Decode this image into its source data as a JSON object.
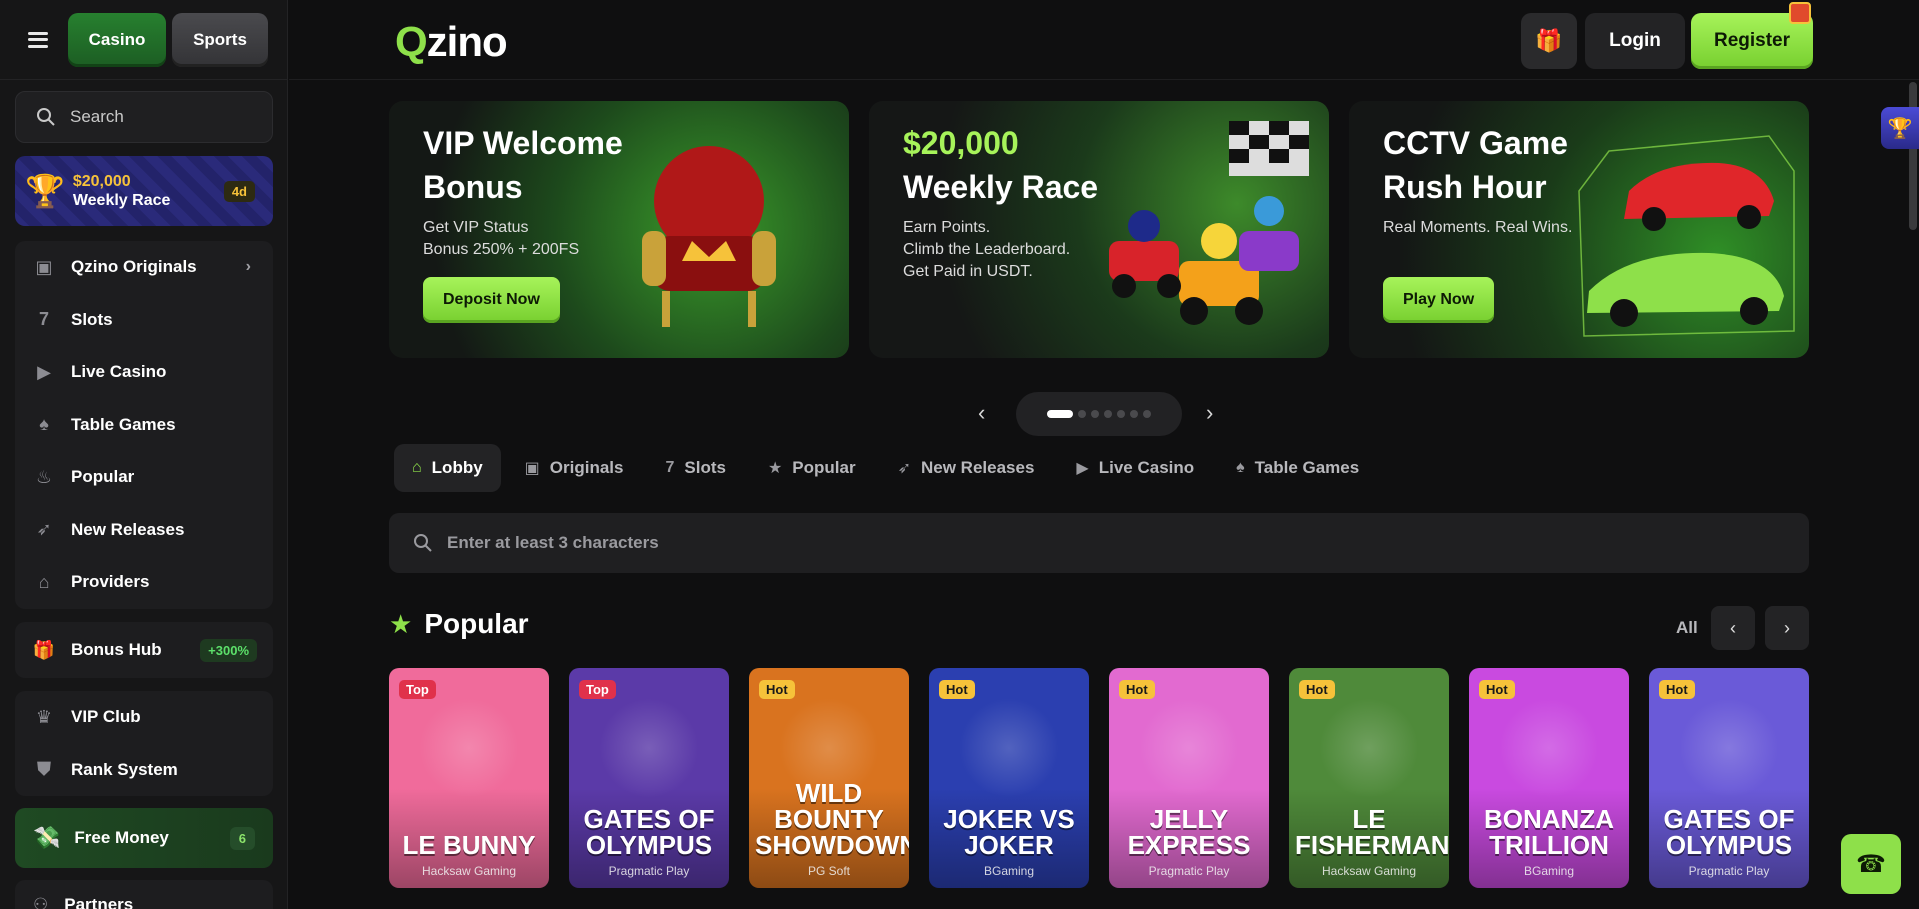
{
  "header": {
    "logo_text": "Qzino",
    "login_label": "Login",
    "register_label": "Register"
  },
  "sidebar": {
    "mode_tabs": [
      "Casino",
      "Sports"
    ],
    "search_label": "Search",
    "race": {
      "amount": "$20,000",
      "label": "Weekly Race",
      "badge": "4d"
    },
    "nav_main": [
      {
        "label": "Qzino Originals",
        "icon": "originals-icon"
      },
      {
        "label": "Slots",
        "icon": "slots-icon"
      },
      {
        "label": "Live Casino",
        "icon": "live-casino-icon"
      },
      {
        "label": "Table Games",
        "icon": "table-games-icon"
      },
      {
        "label": "Popular",
        "icon": "fire-icon"
      },
      {
        "label": "New Releases",
        "icon": "rocket-icon"
      },
      {
        "label": "Providers",
        "icon": "providers-icon"
      }
    ],
    "bonus_hub": {
      "label": "Bonus Hub",
      "badge": "+300%"
    },
    "nav_vip": [
      {
        "label": "VIP Club",
        "icon": "crown-icon"
      },
      {
        "label": "Rank System",
        "icon": "rank-icon"
      }
    ],
    "free_money": {
      "label": "Free Money",
      "badge": "6"
    },
    "partners_label": "Partners"
  },
  "banners": [
    {
      "title_line1": "VIP Welcome",
      "title_line2": "Bonus",
      "sub": [
        "Get VIP Status",
        "Bonus 250% + 200FS"
      ],
      "cta": "Deposit Now"
    },
    {
      "amount": "$20,000",
      "title_line2": "Weekly Race",
      "sub": [
        "Earn Points.",
        "Climb the Leaderboard.",
        "Get Paid in USDT."
      ]
    },
    {
      "title_line1": "CCTV Game",
      "title_line2": "Rush Hour",
      "sub": [
        "Real Moments. Real Wins."
      ],
      "cta": "Play Now"
    }
  ],
  "category_tabs": [
    {
      "label": "Lobby",
      "icon": "home-icon",
      "active": true
    },
    {
      "label": "Originals",
      "icon": "originals-icon"
    },
    {
      "label": "Slots",
      "icon": "slots-icon"
    },
    {
      "label": "Popular",
      "icon": "star-icon"
    },
    {
      "label": "New Releases",
      "icon": "rocket-icon"
    },
    {
      "label": "Live Casino",
      "icon": "live-casino-icon"
    },
    {
      "label": "Table Games",
      "icon": "table-games-icon"
    }
  ],
  "game_search_placeholder": "Enter at least 3 characters",
  "popular": {
    "title": "Popular",
    "all_label": "All",
    "games": [
      {
        "tag": "Top",
        "name": "LE BUNNY",
        "provider": "Hacksaw Gaming",
        "color": "#f06b9b"
      },
      {
        "tag": "Top",
        "name": "GATES OF OLYMPUS",
        "provider": "Pragmatic Play",
        "color": "#5b3aa8"
      },
      {
        "tag": "Hot",
        "name": "WILD BOUNTY SHOWDOWN",
        "provider": "PG Soft",
        "color": "#d9731f"
      },
      {
        "tag": "Hot",
        "name": "JOKER VS JOKER",
        "provider": "BGaming",
        "color": "#2b3fb0"
      },
      {
        "tag": "Hot",
        "name": "JELLY EXPRESS",
        "provider": "Pragmatic Play",
        "color": "#e26ad0"
      },
      {
        "tag": "Hot",
        "name": "LE FISHERMAN",
        "provider": "Hacksaw Gaming",
        "color": "#4f8a3a"
      },
      {
        "tag": "Hot",
        "name": "BONANZA TRILLION",
        "provider": "BGaming",
        "color": "#c94ae0"
      },
      {
        "tag": "Hot",
        "name": "GATES OF OLYMPUS",
        "provider": "Pragmatic Play",
        "color": "#6a5ad8"
      }
    ]
  },
  "colors": {
    "accent": "#8ee04a",
    "gold": "#f6c23a",
    "bg": "#0f0f10"
  }
}
